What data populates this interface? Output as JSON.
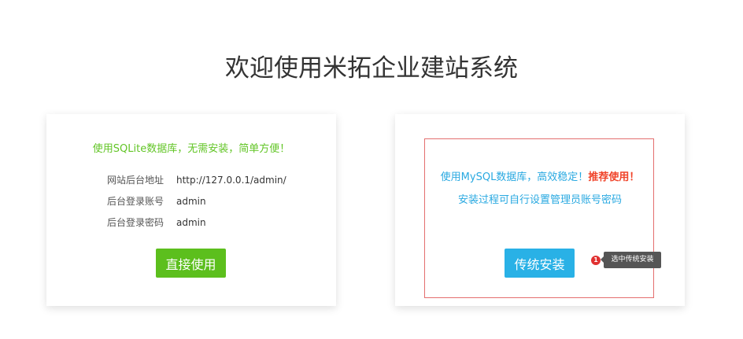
{
  "title": "欢迎使用米拓企业建站系统",
  "sqlite_card": {
    "tagline": "使用SQLite数据库，无需安装，简单方便！",
    "rows": [
      {
        "key": "网站后台地址",
        "value": "http://127.0.0.1/admin/"
      },
      {
        "key": "后台登录账号",
        "value": "admin"
      },
      {
        "key": "后台登录密码",
        "value": "admin"
      }
    ],
    "button_label": "直接使用",
    "button_color": "#5cbf1d"
  },
  "mysql_card": {
    "line1_prefix": "使用MySQL数据库，高效稳定！",
    "line1_recommend": "推荐使用！",
    "line2": "安装过程可自行设置管理员账号密码",
    "button_label": "传统安装",
    "button_color": "#29b1e6",
    "highlight_color": "#e46f6f"
  },
  "annotation": {
    "step_number": "1",
    "tooltip": "选中传统安装"
  }
}
